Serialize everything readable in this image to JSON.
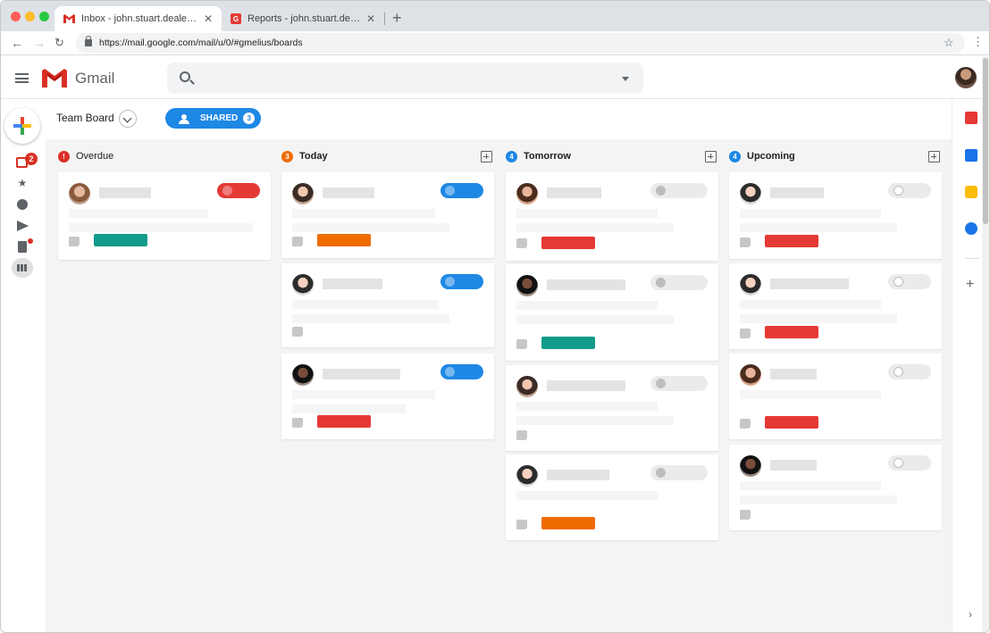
{
  "browser": {
    "tabs": [
      {
        "label": "Inbox - john.stuart.dealet@g...",
        "active": true
      },
      {
        "label": "Reports - john.stuart.dealet...",
        "active": false
      }
    ],
    "url": "https://mail.google.com/mail/u/0/#gmelius/boards"
  },
  "gmail": {
    "logo_text": "Gmail",
    "inbox_badge": "2"
  },
  "board": {
    "title": "Team Board",
    "shared_label": "SHARED",
    "shared_count": "3",
    "columns": [
      {
        "title": "Overdue",
        "badge": "!",
        "badge_color": "#d93025"
      },
      {
        "title": "Today",
        "badge": "3",
        "badge_color": "#ef6c00"
      },
      {
        "title": "Tomorrow",
        "badge": "4",
        "badge_color": "#1e88e5"
      },
      {
        "title": "Upcoming",
        "badge": "4",
        "badge_color": "#1e88e5"
      }
    ]
  },
  "colors": {
    "accent": "#1e88e5",
    "label_teal": "#129b8b",
    "label_orange": "#ef6c00",
    "label_red": "#e53935",
    "status_red": "#e53935",
    "status_grey": "#ebebeb"
  }
}
